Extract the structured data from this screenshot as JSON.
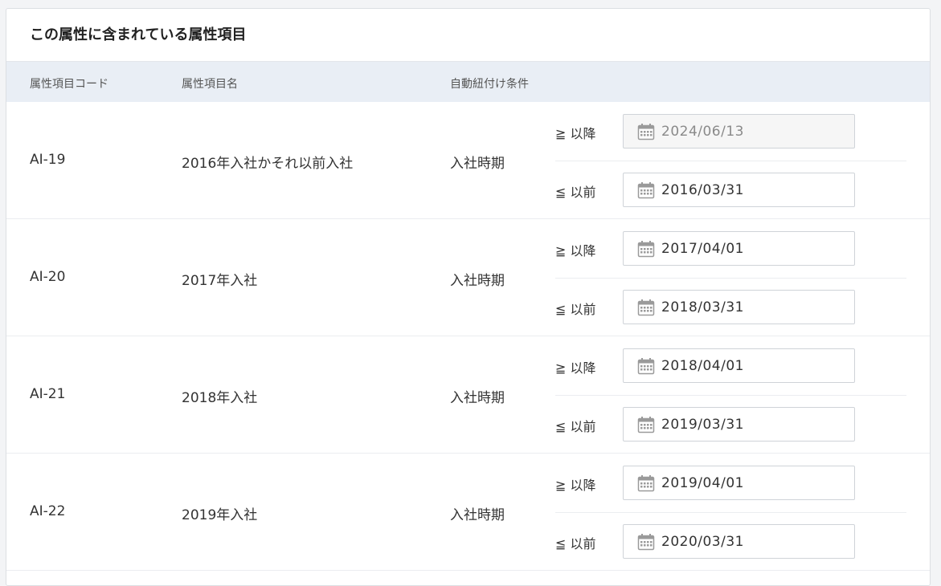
{
  "card": {
    "title": "この属性に含まれている属性項目"
  },
  "table": {
    "headers": {
      "code": "属性項目コード",
      "name": "属性項目名",
      "condition": "自動紐付け条件"
    },
    "labels": {
      "from": "≧ 以降",
      "to": "≦ 以前"
    },
    "rows": [
      {
        "code": "AI-19",
        "name": "2016年入社かそれ以前入社",
        "condition": "入社時期",
        "from": "2024/06/13",
        "to": "2016/03/31"
      },
      {
        "code": "AI-20",
        "name": "2017年入社",
        "condition": "入社時期",
        "from": "2017/04/01",
        "to": "2018/03/31"
      },
      {
        "code": "AI-21",
        "name": "2018年入社",
        "condition": "入社時期",
        "from": "2018/04/01",
        "to": "2019/03/31"
      },
      {
        "code": "AI-22",
        "name": "2019年入社",
        "condition": "入社時期",
        "from": "2019/04/01",
        "to": "2020/03/31"
      }
    ]
  },
  "icons": {
    "date": "calendar-icon"
  },
  "colors": {
    "header_bg": "#e9eef5",
    "disabled_bg": "#f6f6f6"
  }
}
